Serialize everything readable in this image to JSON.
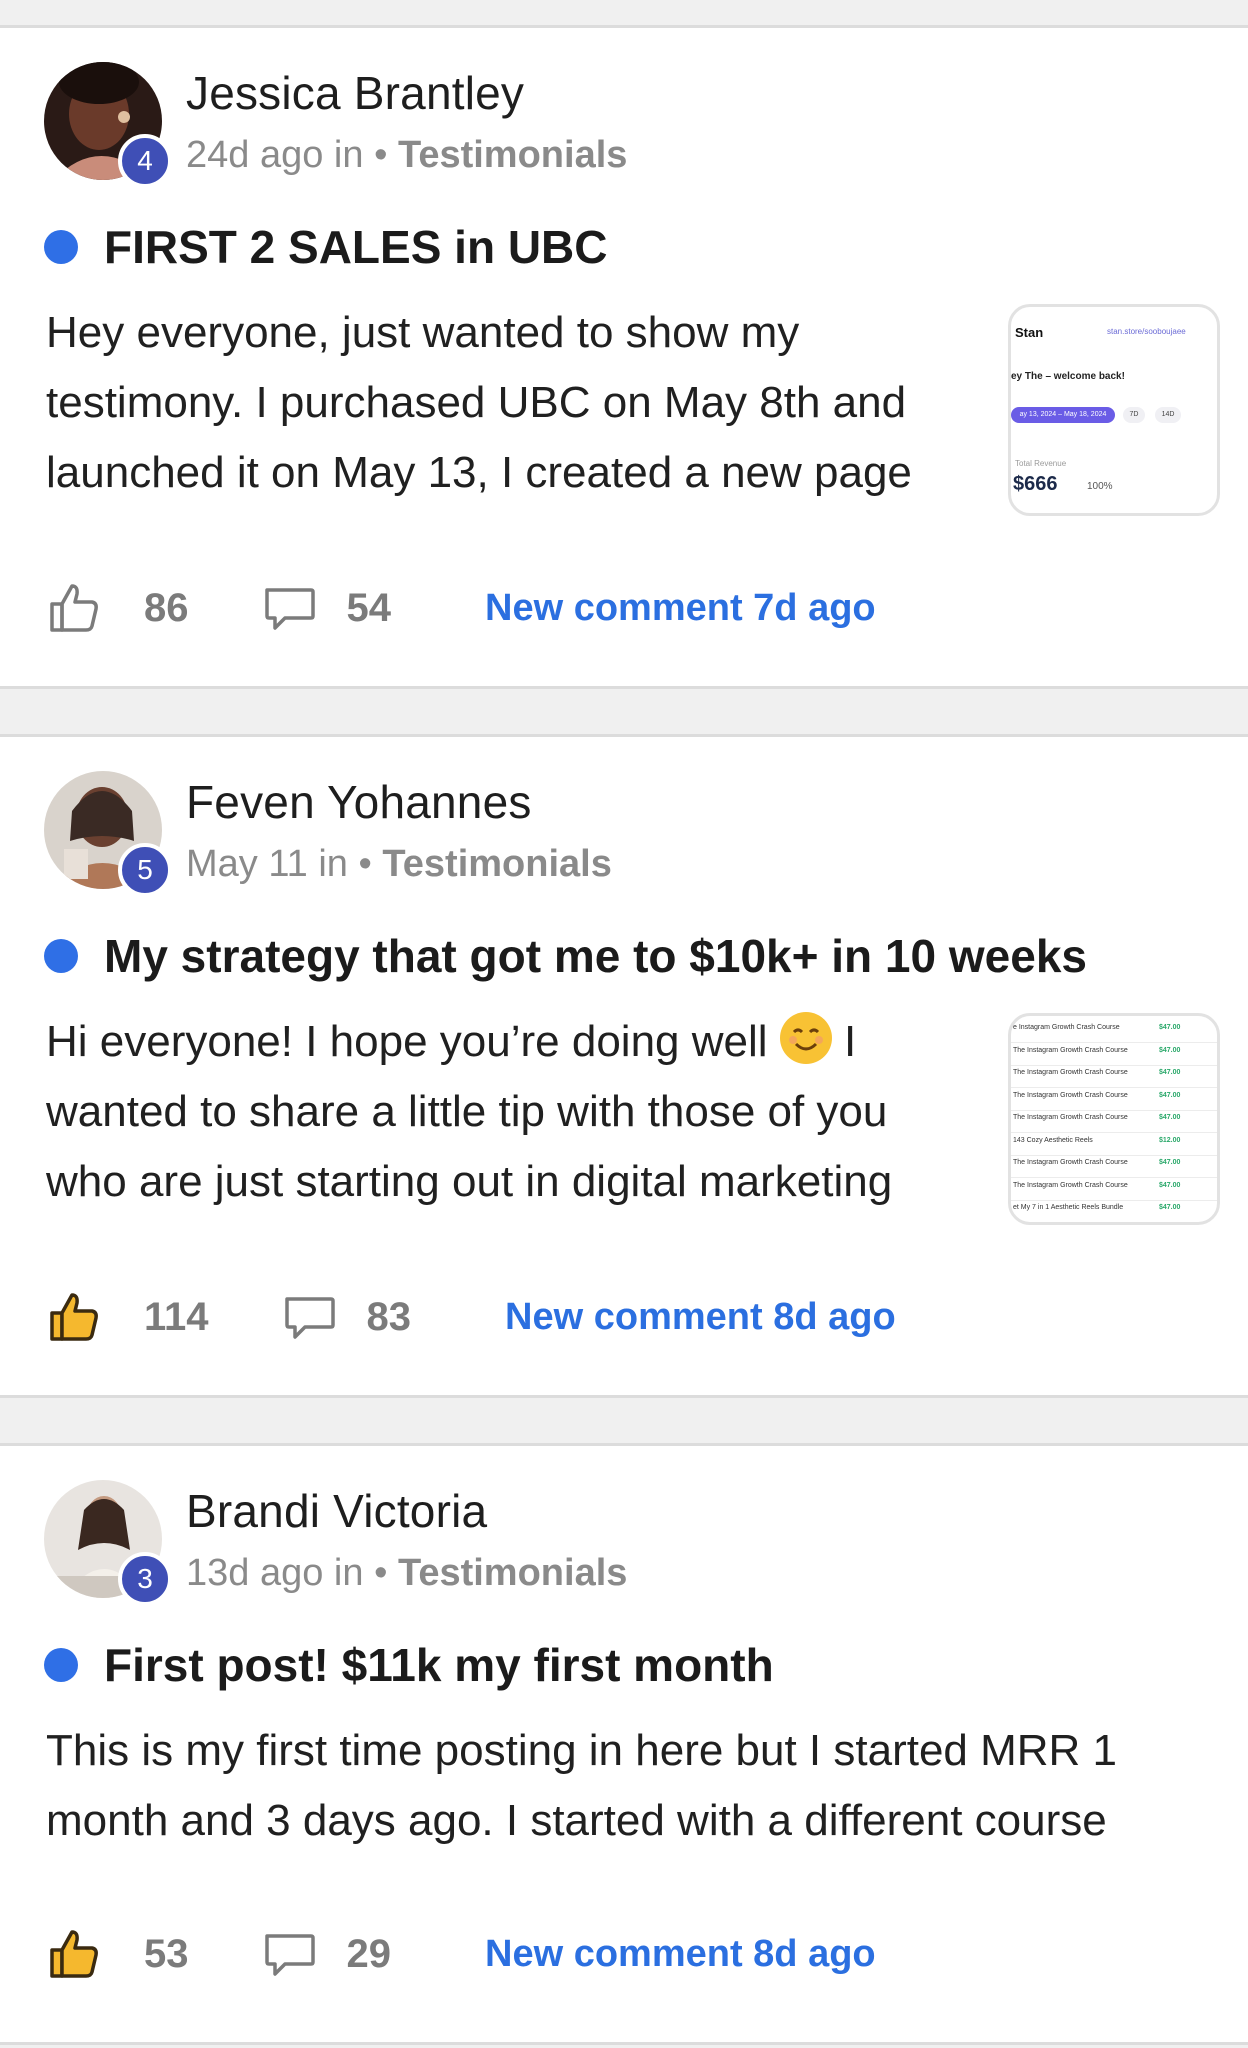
{
  "posts": [
    {
      "author": "Jessica Brantley",
      "level": "4",
      "time": "24d ago in",
      "separator": "•",
      "category": "Testimonials",
      "title": "FIRST 2 SALES in UBC",
      "body_lines": [
        "Hey everyone, just wanted to show my",
        "testimony. I purchased UBC on May 8th and",
        "launched it on May 13, I created a new page"
      ],
      "likes": "86",
      "comments": "54",
      "new_comment": "New comment 7d ago",
      "liked": false,
      "thumbnail": {
        "brand": "Stan",
        "url": "stan.store/sooboujaee",
        "welcome": "ey The – welcome back!",
        "date_range": "ay 13, 2024 – May 18, 2024",
        "chip_7d": "7D",
        "chip_14d": "14D",
        "revenue_label": "Total Revenue",
        "revenue_value": "$666",
        "revenue_change": "100%"
      }
    },
    {
      "author": "Feven Yohannes",
      "level": "5",
      "time": "May 11 in",
      "separator": "•",
      "category": "Testimonials",
      "title": "My strategy that got me to $10k+ in 10 weeks",
      "body_lines": [
        "Hi everyone! I hope you’re doing well",
        "wanted to share a little tip with those of you",
        "who are just starting out in digital marketing"
      ],
      "body_line1_suffix": "I",
      "likes": "114",
      "comments": "83",
      "new_comment": "New comment 8d ago",
      "liked": true,
      "thumbnail": {
        "rows": [
          {
            "name": "e Instagram Growth Crash Course",
            "price": "$47.00"
          },
          {
            "name": "The Instagram Growth Crash Course",
            "price": "$47.00"
          },
          {
            "name": "The Instagram Growth Crash Course",
            "price": "$47.00"
          },
          {
            "name": "The Instagram Growth Crash Course",
            "price": "$47.00"
          },
          {
            "name": "The Instagram Growth Crash Course",
            "price": "$47.00"
          },
          {
            "name": "143 Cozy Aesthetic Reels",
            "price": "$12.00"
          },
          {
            "name": "The Instagram Growth Crash Course",
            "price": "$47.00"
          },
          {
            "name": "The Instagram Growth Crash Course",
            "price": "$47.00"
          },
          {
            "name": "et My 7 in 1 Aesthetic Reels Bundle",
            "price": "$47.00"
          }
        ]
      }
    },
    {
      "author": "Brandi Victoria",
      "level": "3",
      "time": "13d ago in",
      "separator": "•",
      "category": "Testimonials",
      "title": "First post! $11k my first month",
      "body_lines": [
        "This is my first time posting in here but I started MRR 1",
        "month and 3 days ago. I started with a different course"
      ],
      "likes": "53",
      "comments": "29",
      "new_comment": "New comment 8d ago",
      "liked": true
    }
  ],
  "colors": {
    "accent": "#2f6fe6",
    "level_badge": "#3f4fb6",
    "like_filled": "#f5b82e"
  },
  "icons": [
    "thumbs-up-icon",
    "comment-bubble-icon"
  ]
}
